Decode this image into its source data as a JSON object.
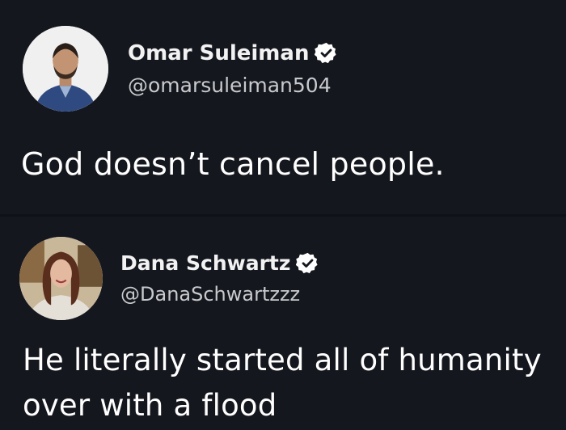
{
  "tweets": [
    {
      "display_name": "Omar Suleiman",
      "handle": "@omarsuleiman504",
      "text": "God doesn’t cancel people.",
      "verified_icon": "verified-badge-icon"
    },
    {
      "display_name": "Dana Schwartz",
      "handle": "@DanaSchwartzzz",
      "text": "He literally started all of humanity over with a flood",
      "verified_icon": "verified-badge-icon"
    }
  ],
  "colors": {
    "background": "#15171f",
    "text": "#ffffff",
    "handle": "#c8c9cc"
  }
}
